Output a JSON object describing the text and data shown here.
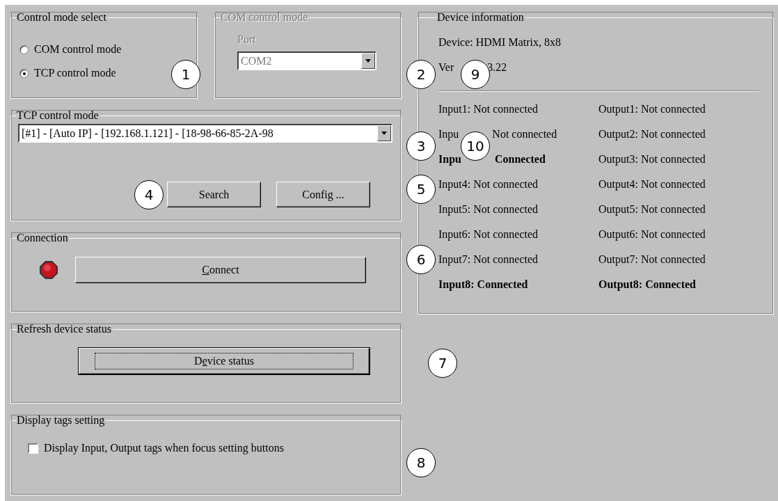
{
  "control_mode_select": {
    "title": "Control mode select",
    "options": [
      {
        "label": "COM control mode",
        "selected": false
      },
      {
        "label": "TCP control mode",
        "selected": true
      }
    ]
  },
  "com_control_mode": {
    "title": "COM control mode",
    "disabled": true,
    "port_label": "Port",
    "port_value": "COM2"
  },
  "tcp_control_mode": {
    "title": "TCP control mode",
    "device_value": "[#1] - [Auto IP] - [192.168.1.121] - [18-98-66-85-2A-98",
    "buttons": [
      "Search",
      "Config ..."
    ]
  },
  "connection": {
    "title": "Connection",
    "connected": false,
    "button": "Connect"
  },
  "refresh_device_status": {
    "title": "Refresh device status",
    "button": {
      "label": "Device status",
      "focused": true
    }
  },
  "display_tags_setting": {
    "title": "Display tags setting",
    "checkbox": {
      "label": "Display Input, Output tags when focus setting buttons",
      "checked": false
    }
  },
  "device_information": {
    "title": "Device information",
    "device": "Device: HDMI Matrix, 8x8",
    "version": [
      "Ver",
      "3.22"
    ],
    "inputs": [
      {
        "segments": [
          "Input1: Not connected"
        ],
        "connected": false
      },
      {
        "segments": [
          "Inpu",
          "Not connected"
        ],
        "connected": false
      },
      {
        "segments": [
          "Inpu",
          "Connected"
        ],
        "connected": true
      },
      {
        "segments": [
          "Input4: Not connected"
        ],
        "connected": false
      },
      {
        "segments": [
          "Input5: Not connected"
        ],
        "connected": false
      },
      {
        "segments": [
          "Input6: Not connected"
        ],
        "connected": false
      },
      {
        "segments": [
          "Input7: Not connected"
        ],
        "connected": false
      },
      {
        "segments": [
          "Input8: Connected"
        ],
        "connected": true
      }
    ],
    "outputs": [
      {
        "segments": [
          "Output1: Not connected"
        ],
        "connected": false
      },
      {
        "segments": [
          "Output2: Not connected"
        ],
        "connected": false
      },
      {
        "segments": [
          "Output3: Not connected"
        ],
        "connected": false
      },
      {
        "segments": [
          "Output4: Not connected"
        ],
        "connected": false
      },
      {
        "segments": [
          "Output5: Not connected"
        ],
        "connected": false
      },
      {
        "segments": [
          "Output6: Not connected"
        ],
        "connected": false
      },
      {
        "segments": [
          "Output7: Not connected"
        ],
        "connected": false
      },
      {
        "segments": [
          "Output8: Connected"
        ],
        "connected": true
      }
    ]
  },
  "callouts": [
    "1",
    "2",
    "3",
    "4",
    "5",
    "6",
    "7",
    "8",
    "9",
    "10"
  ]
}
